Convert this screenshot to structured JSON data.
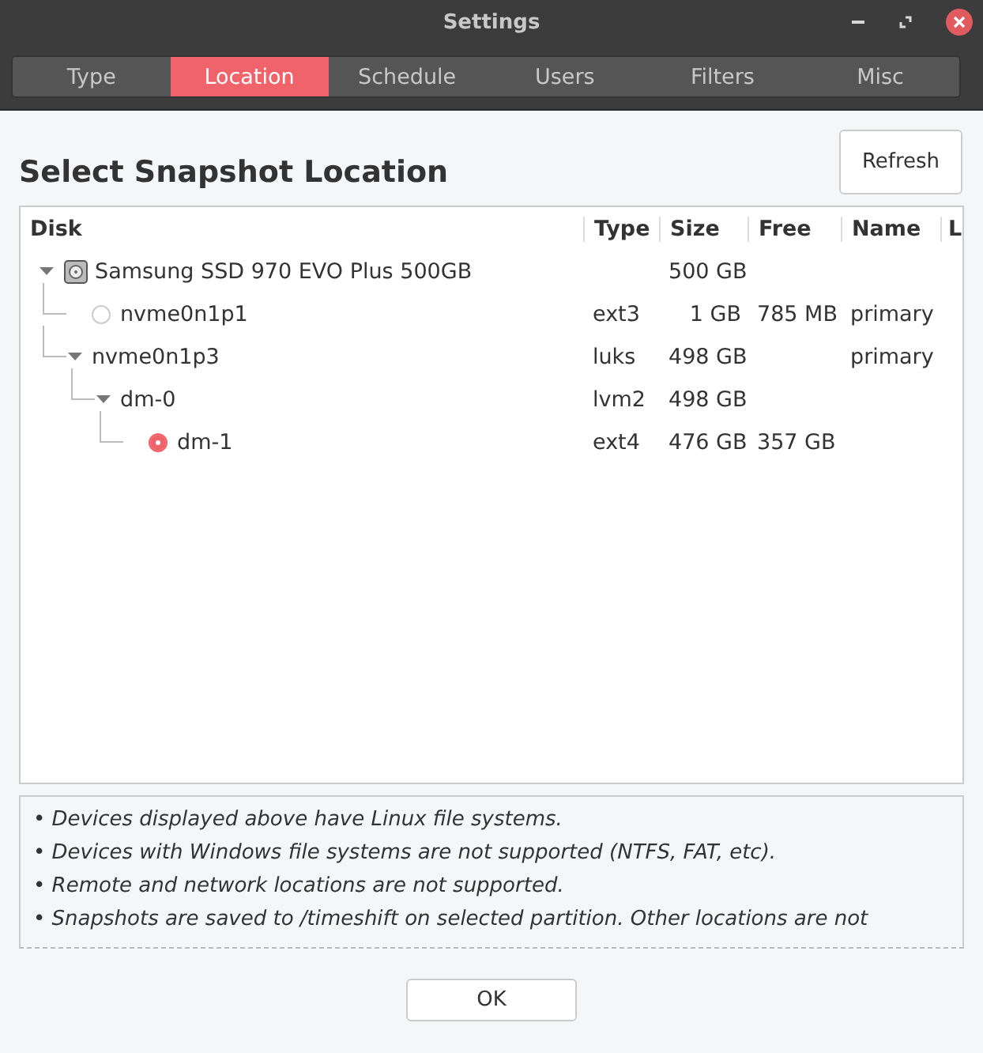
{
  "window": {
    "title": "Settings"
  },
  "tabs": [
    {
      "label": "Type",
      "selected": false
    },
    {
      "label": "Location",
      "selected": true
    },
    {
      "label": "Schedule",
      "selected": false
    },
    {
      "label": "Users",
      "selected": false
    },
    {
      "label": "Filters",
      "selected": false
    },
    {
      "label": "Misc",
      "selected": false
    }
  ],
  "heading": "Select Snapshot Location",
  "refresh_button": "Refresh",
  "table": {
    "columns": [
      "Disk",
      "Type",
      "Size",
      "Free",
      "Name",
      "L"
    ],
    "rows": [
      {
        "kind": "disk",
        "label": "Samsung SSD 970 EVO Plus 500GB",
        "size": "500 GB",
        "expanded": true,
        "children": [
          {
            "kind": "volume",
            "label": "nvme0n1p1",
            "type": "ext3",
            "size": "1 GB",
            "free": "785 MB",
            "name": "primary",
            "selected": false
          },
          {
            "kind": "container",
            "label": "nvme0n1p3",
            "type": "luks",
            "size": "498 GB",
            "name": "primary",
            "expanded": true,
            "children": [
              {
                "kind": "container",
                "label": "dm-0",
                "type": "lvm2",
                "size": "498 GB",
                "expanded": true,
                "children": [
                  {
                    "kind": "volume",
                    "label": "dm-1",
                    "type": "ext4",
                    "size": "476 GB",
                    "free": "357 GB",
                    "selected": true
                  }
                ]
              }
            ]
          }
        ]
      }
    ]
  },
  "notes": [
    "• Devices displayed above have Linux file systems.",
    "• Devices with Windows file systems are not supported (NTFS, FAT, etc).",
    "• Remote and network locations are not supported.",
    "• Snapshots are saved to /timeshift on selected partition. Other locations are not"
  ],
  "ok_button": "OK"
}
